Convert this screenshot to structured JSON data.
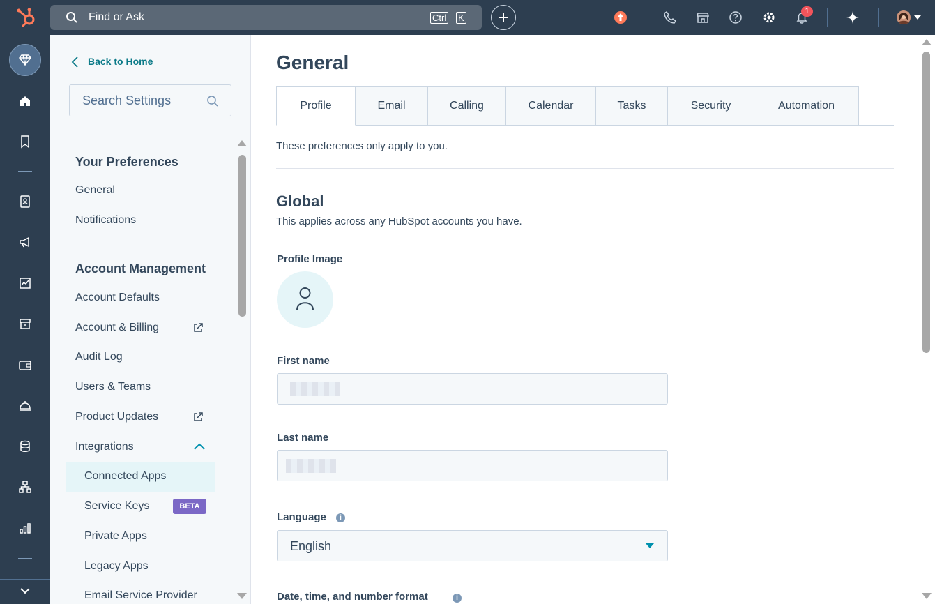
{
  "topbar": {
    "search_placeholder": "Find or Ask",
    "shortcut_ctrl": "Ctrl",
    "shortcut_k": "K",
    "notification_count": "1",
    "brand_color": "#ff7a59"
  },
  "sidebar": {
    "back_label": "Back to Home",
    "search_placeholder": "Search Settings",
    "sections": {
      "preferences_title": "Your Preferences",
      "preferences_items": [
        "General",
        "Notifications"
      ],
      "account_title": "Account Management",
      "account_items": [
        "Account Defaults",
        "Account & Billing",
        "Audit Log",
        "Users & Teams",
        "Product Updates",
        "Integrations"
      ],
      "integrations_items": [
        "Connected Apps",
        "Service Keys",
        "Private Apps",
        "Legacy Apps",
        "Email Service Provider"
      ],
      "beta_label": "BETA"
    }
  },
  "main": {
    "title": "General",
    "tabs": [
      "Profile",
      "Email",
      "Calling",
      "Calendar",
      "Tasks",
      "Security",
      "Automation"
    ],
    "active_tab": "Profile",
    "note": "These preferences only apply to you.",
    "global_title": "Global",
    "global_subtitle": "This applies across any HubSpot accounts you have.",
    "profile_image_label": "Profile Image",
    "first_name_label": "First name",
    "last_name_label": "Last name",
    "language_label": "Language",
    "language_value": "English",
    "date_format_label": "Date, time, and number format"
  }
}
